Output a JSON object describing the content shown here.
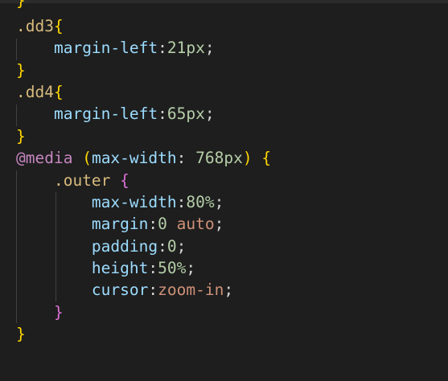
{
  "editor": {
    "theme": "dark",
    "colors": {
      "background": "#1e1e1e",
      "brace_gold": "#ffd700",
      "brace_purple": "#da70d6",
      "selector": "#d7ba7d",
      "property": "#9cdcfe",
      "number": "#b5cea8",
      "value": "#ce9178",
      "at_rule": "#c586c0"
    },
    "lines": [
      {
        "brace": "}"
      },
      {
        "selector": ".dd3",
        "brace": "{"
      },
      {
        "prop": "margin-left",
        "colon": ":",
        "num": "21px",
        "semi": ";"
      },
      {
        "brace": "}"
      },
      {
        "selector": ".dd4",
        "brace": "{"
      },
      {
        "prop": "margin-left",
        "colon": ":",
        "num": "65px",
        "semi": ";"
      },
      {
        "brace": "}"
      },
      {
        "at": "@media",
        "open_paren": "(",
        "prop": "max-width",
        "colon": ":",
        "num": "768px",
        "close_paren": ")",
        "brace": "{"
      },
      {
        "selector": ".outer",
        "brace": "{"
      },
      {
        "prop": "max-width",
        "colon": ":",
        "num": "80%",
        "semi": ";"
      },
      {
        "prop": "margin",
        "colon": ":",
        "num": "0",
        "val": "auto",
        "semi": ";"
      },
      {
        "prop": "padding",
        "colon": ":",
        "num": "0",
        "semi": ";"
      },
      {
        "prop": "height",
        "colon": ":",
        "num": "50%",
        "semi": ";"
      },
      {
        "prop": "cursor",
        "colon": ":",
        "val": "zoom-in",
        "semi": ";"
      },
      {
        "brace": "}"
      },
      {
        "brace": "}"
      }
    ]
  }
}
